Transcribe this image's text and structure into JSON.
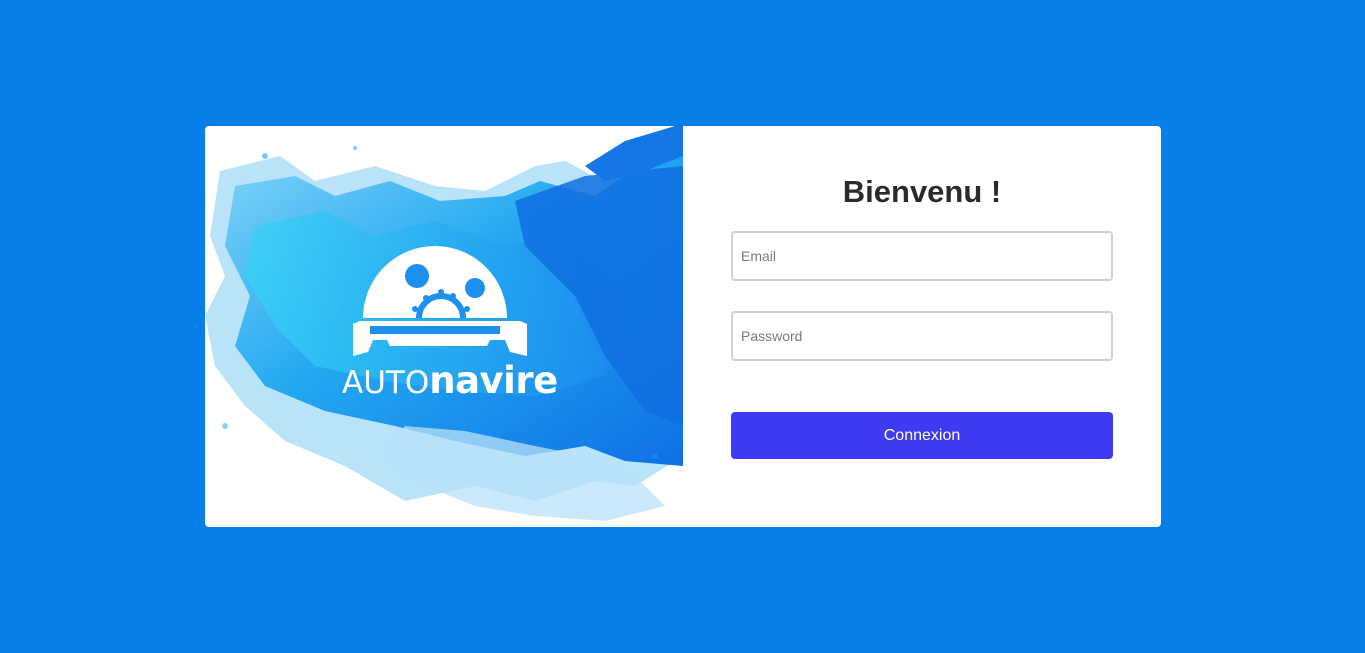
{
  "brand": {
    "logo_word_1": "AUTO",
    "logo_word_2": "navire",
    "logo_icon": "gear-wrench-icon",
    "colors": {
      "page_background": "#0680e8",
      "accent_blue": "#1d8fec",
      "light_blue": "#78c8f4",
      "cyan": "#21c8f5",
      "white": "#ffffff"
    }
  },
  "login": {
    "title": "Bienvenu !",
    "email_placeholder": "Email",
    "password_placeholder": "Password",
    "submit_label": "Connexion",
    "submit_color": "#403bf2"
  }
}
